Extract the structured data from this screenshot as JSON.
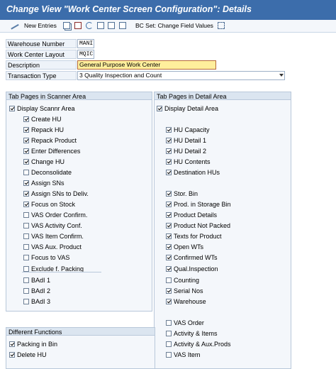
{
  "title": "Change View \"Work Center Screen Configuration\": Details",
  "toolbar": {
    "new_entries": "New Entries",
    "bc_set": "BC Set: Change Field Values"
  },
  "form": {
    "warehouse_label": "Warehouse Number",
    "warehouse_value": "MANI",
    "layout_label": "Work Center Layout",
    "layout_value": "MQIC",
    "description_label": "Description",
    "description_value": "General Purpose Work Center",
    "transaction_label": "Transaction Type",
    "transaction_value": "3 Quality Inspection and Count"
  },
  "scanner": {
    "title": "Tab Pages in Scanner Area",
    "items": [
      {
        "label": "Display Scannr Area",
        "checked": true
      },
      {
        "label": "Create HU",
        "checked": true
      },
      {
        "label": "Repack HU",
        "checked": true
      },
      {
        "label": "Repack Product",
        "checked": true
      },
      {
        "label": "Enter Differences",
        "checked": true
      },
      {
        "label": "Change HU",
        "checked": true
      },
      {
        "label": "Deconsolidate",
        "checked": false
      },
      {
        "label": "Assign SNs",
        "checked": true
      },
      {
        "label": "Assign SNs to Deliv.",
        "checked": true
      },
      {
        "label": "Focus on Stock",
        "checked": true
      },
      {
        "label": "VAS Order Confirm.",
        "checked": false
      },
      {
        "label": "VAS Activity Conf.",
        "checked": false
      },
      {
        "label": "VAS Item Confirm.",
        "checked": false
      },
      {
        "label": "VAS Aux. Product",
        "checked": false
      },
      {
        "label": "Focus to VAS",
        "checked": false
      },
      {
        "label": "Exclude f. Packing",
        "checked": false
      },
      {
        "label": "BAdI 1",
        "checked": false
      },
      {
        "label": "BAdI 2",
        "checked": false
      },
      {
        "label": "BAdI 3",
        "checked": false
      }
    ]
  },
  "detail": {
    "title": "Tab Pages in Detail Area",
    "items": [
      {
        "label": "Display Detail Area",
        "checked": true
      },
      {
        "label": "HU Capacity",
        "checked": true
      },
      {
        "label": "HU Detail 1",
        "checked": true
      },
      {
        "label": "HU Detail 2",
        "checked": true
      },
      {
        "label": "HU Contents",
        "checked": true
      },
      {
        "label": "Destination HUs",
        "checked": true
      },
      {
        "label": "Stor. Bin",
        "checked": true
      },
      {
        "label": "Prod. in Storage Bin",
        "checked": true
      },
      {
        "label": "Product Details",
        "checked": true
      },
      {
        "label": "Product Not Packed",
        "checked": true
      },
      {
        "label": "Texts for Product",
        "checked": true
      },
      {
        "label": "Open WTs",
        "checked": true
      },
      {
        "label": "Confirmed WTs",
        "checked": true
      },
      {
        "label": "Qual.Inspection",
        "checked": true
      },
      {
        "label": "Counting",
        "checked": false
      },
      {
        "label": "Serial Nos",
        "checked": true
      },
      {
        "label": "Warehouse",
        "checked": true
      },
      {
        "label": "VAS Order",
        "checked": false
      },
      {
        "label": "Activity & Items",
        "checked": false
      },
      {
        "label": "Activity & Aux.Prods",
        "checked": false
      },
      {
        "label": "VAS Item",
        "checked": false
      }
    ]
  },
  "functions": {
    "title": "Different Functions",
    "items": [
      {
        "label": "Packing in Bin",
        "checked": true
      },
      {
        "label": "Delete HU",
        "checked": true
      }
    ]
  }
}
